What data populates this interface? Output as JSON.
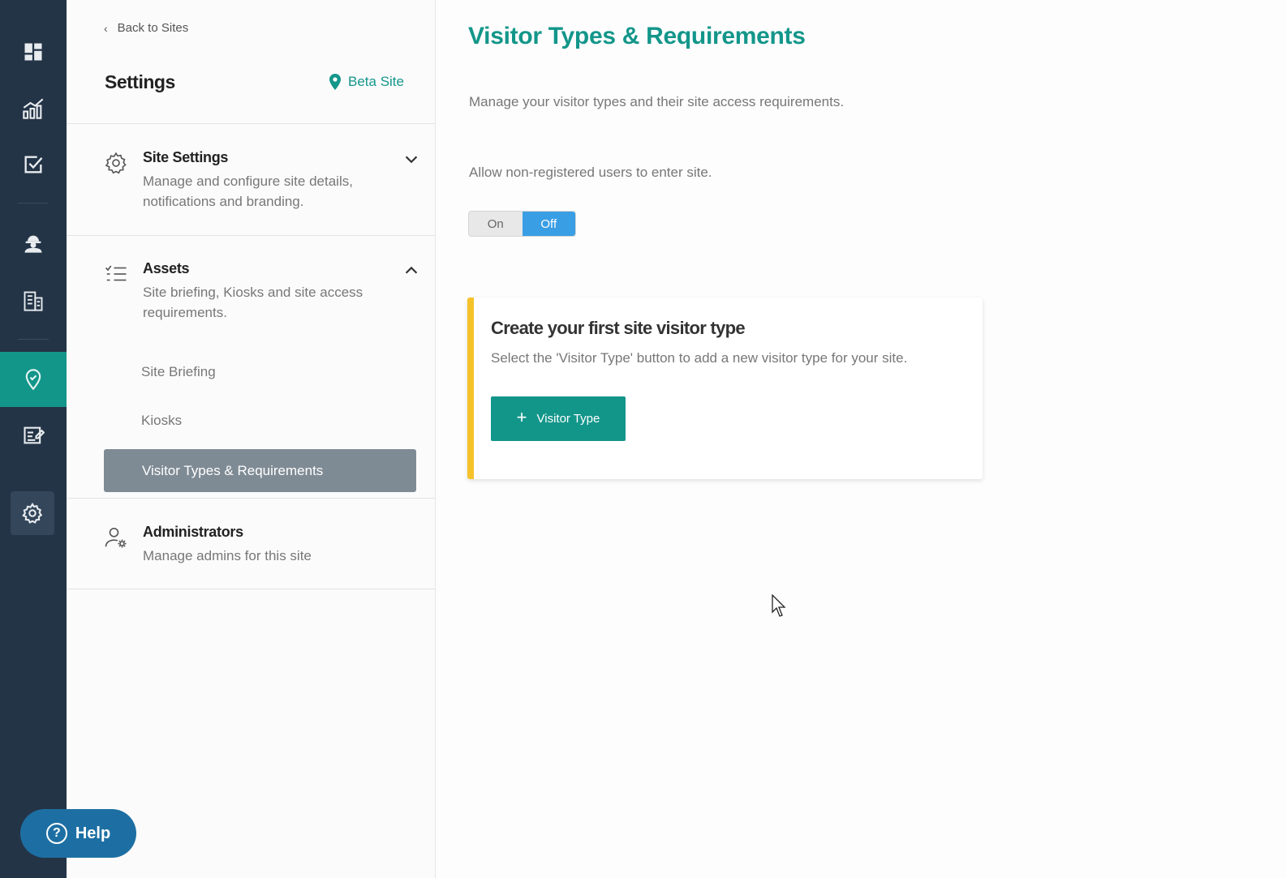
{
  "nav": {
    "items": [
      {
        "icon": "dashboard-icon"
      },
      {
        "icon": "analytics-icon"
      },
      {
        "icon": "tasks-checkbox-icon"
      },
      {
        "icon": "worker-icon"
      },
      {
        "icon": "buildings-icon"
      },
      {
        "icon": "sites-location-icon",
        "active": true
      },
      {
        "icon": "forms-icon"
      },
      {
        "icon": "settings-gear-icon",
        "active": true
      }
    ],
    "active_color": "#13968a",
    "background": "#243447"
  },
  "panel": {
    "back_label": "Back to Sites",
    "title": "Settings",
    "site_name": "Beta Site",
    "sections": [
      {
        "icon": "gear-icon",
        "title": "Site Settings",
        "description": "Manage and configure site details, notifications and branding.",
        "expanded": false
      },
      {
        "icon": "checklist-icon",
        "title": "Assets",
        "description": "Site briefing, Kiosks and site access requirements.",
        "expanded": true,
        "items": [
          {
            "label": "Site Briefing"
          },
          {
            "label": "Kiosks"
          },
          {
            "label": "Visitor Types & Requirements",
            "active": true
          }
        ]
      },
      {
        "icon": "admin-user-gear-icon",
        "title": "Administrators",
        "description": "Manage admins for this site"
      }
    ]
  },
  "main": {
    "title": "Visitor Types & Requirements",
    "description": "Manage your visitor types and their site access requirements.",
    "allow_label": "Allow non-registered users to enter site.",
    "switch": {
      "on_label": "On",
      "off_label": "Off",
      "selected": "Off"
    },
    "card": {
      "title": "Create your first site visitor type",
      "description": "Select the 'Visitor Type' button to add a new visitor type for your site.",
      "button_label": "Visitor Type",
      "accent": "#f5c22a"
    }
  },
  "help": {
    "label": "Help"
  }
}
